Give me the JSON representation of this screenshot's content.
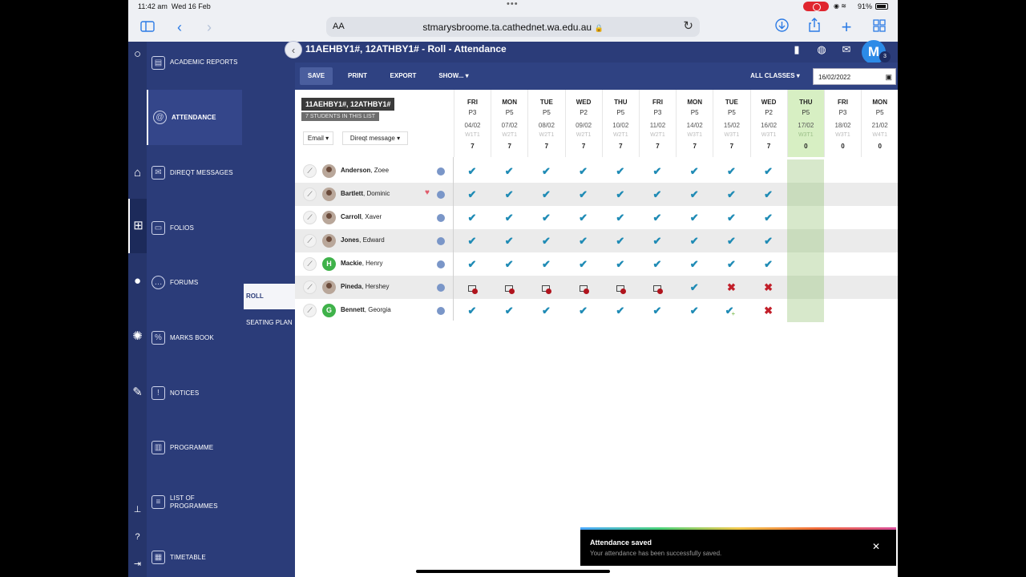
{
  "status_bar": {
    "time": "11:42 am",
    "date": "Wed 16 Feb",
    "battery": "91%"
  },
  "browser": {
    "aa": "AA",
    "url": "stmarysbroome.ta.cathednet.wa.edu.au"
  },
  "sidebar": {
    "items": [
      {
        "label": "ACADEMIC REPORTS",
        "icon": "report-icon"
      },
      {
        "label": "ATTENDANCE",
        "icon": "at-icon"
      },
      {
        "label": "DIREQT MESSAGES",
        "icon": "envelope-icon"
      },
      {
        "label": "FOLIOS",
        "icon": "folder-icon"
      },
      {
        "label": "FORUMS",
        "icon": "chat-icon"
      },
      {
        "label": "MARKS BOOK",
        "icon": "marks-icon"
      },
      {
        "label": "NOTICES",
        "icon": "notice-icon"
      },
      {
        "label": "PROGRAMME",
        "icon": "book-icon"
      },
      {
        "label": "LIST OF PROGRAMMES",
        "icon": "list-icon"
      },
      {
        "label": "TIMETABLE",
        "icon": "calendar-icon"
      }
    ]
  },
  "submenu": {
    "items": [
      "ROLL",
      "SEATING PLAN"
    ]
  },
  "header": {
    "title": "11AEHBY1#, 12ATHBY1# - Roll - Attendance",
    "avatar_letter": "M",
    "avatar_count": "3"
  },
  "toolbar": {
    "save": "SAVE",
    "print": "PRINT",
    "export": "EXPORT",
    "show": "SHOW... ▾",
    "all_classes": "ALL CLASSES ▾",
    "date": "16/02/2022"
  },
  "roll": {
    "class_name": "11AEHBY1#, 12ATHBY1#",
    "student_count_label": "7 STUDENTS IN THIS LIST",
    "email_btn": "Email ▾",
    "direqt_btn": "Direqt message ▾",
    "columns": [
      {
        "day": "FRI",
        "period": "P3",
        "date": "04/02",
        "week": "W1T1",
        "count": "7"
      },
      {
        "day": "MON",
        "period": "P5",
        "date": "07/02",
        "week": "W2T1",
        "count": "7"
      },
      {
        "day": "TUE",
        "period": "P5",
        "date": "08/02",
        "week": "W2T1",
        "count": "7"
      },
      {
        "day": "WED",
        "period": "P2",
        "date": "09/02",
        "week": "W2T1",
        "count": "7"
      },
      {
        "day": "THU",
        "period": "P5",
        "date": "10/02",
        "week": "W2T1",
        "count": "7"
      },
      {
        "day": "FRI",
        "period": "P3",
        "date": "11/02",
        "week": "W2T1",
        "count": "7"
      },
      {
        "day": "MON",
        "period": "P5",
        "date": "14/02",
        "week": "W3T1",
        "count": "7"
      },
      {
        "day": "TUE",
        "period": "P5",
        "date": "15/02",
        "week": "W3T1",
        "count": "7"
      },
      {
        "day": "WED",
        "period": "P2",
        "date": "16/02",
        "week": "W3T1",
        "count": "7"
      },
      {
        "day": "THU",
        "period": "P5",
        "date": "17/02",
        "week": "W3T1",
        "count": "0"
      },
      {
        "day": "FRI",
        "period": "P3",
        "date": "18/02",
        "week": "W3T1",
        "count": "0"
      },
      {
        "day": "MON",
        "period": "P5",
        "date": "21/02",
        "week": "W4T1",
        "count": "0"
      }
    ],
    "students": [
      {
        "surname": "Anderson",
        "given": "Zoee",
        "avatar": "photo",
        "letter": "",
        "heart": false,
        "marks": [
          "P",
          "P",
          "P",
          "P",
          "P",
          "P",
          "P",
          "P",
          "P",
          "",
          "",
          ""
        ]
      },
      {
        "surname": "Bartlett",
        "given": "Dominic",
        "avatar": "photo",
        "letter": "",
        "heart": true,
        "marks": [
          "P",
          "P",
          "P",
          "P",
          "P",
          "P",
          "P",
          "P",
          "P",
          "",
          "",
          ""
        ]
      },
      {
        "surname": "Carroll",
        "given": "Xaver",
        "avatar": "photo",
        "letter": "",
        "heart": false,
        "marks": [
          "P",
          "P",
          "P",
          "P",
          "P",
          "P",
          "P",
          "P",
          "P",
          "",
          "",
          ""
        ]
      },
      {
        "surname": "Jones",
        "given": "Edward",
        "avatar": "photo",
        "letter": "",
        "heart": false,
        "marks": [
          "P",
          "P",
          "P",
          "P",
          "P",
          "P",
          "P",
          "P",
          "P",
          "",
          "",
          ""
        ]
      },
      {
        "surname": "Mackie",
        "given": "Henry",
        "avatar": "letter",
        "letter": "H",
        "heart": false,
        "marks": [
          "P",
          "P",
          "P",
          "P",
          "P",
          "P",
          "P",
          "P",
          "P",
          "",
          "",
          ""
        ]
      },
      {
        "surname": "Pineda",
        "given": "Hershey",
        "avatar": "photo",
        "letter": "",
        "heart": false,
        "marks": [
          "L",
          "L",
          "L",
          "L",
          "L",
          "L",
          "P",
          "A",
          "A",
          "",
          "",
          ""
        ]
      },
      {
        "surname": "Bennett",
        "given": "Georgia",
        "avatar": "letter",
        "letter": "G",
        "heart": false,
        "marks": [
          "P",
          "P",
          "P",
          "P",
          "P",
          "P",
          "P",
          "E",
          "A",
          "",
          "",
          ""
        ]
      }
    ]
  },
  "toast": {
    "title": "Attendance saved",
    "message": "Your attendance has been successfully saved.",
    "close": "✕"
  }
}
